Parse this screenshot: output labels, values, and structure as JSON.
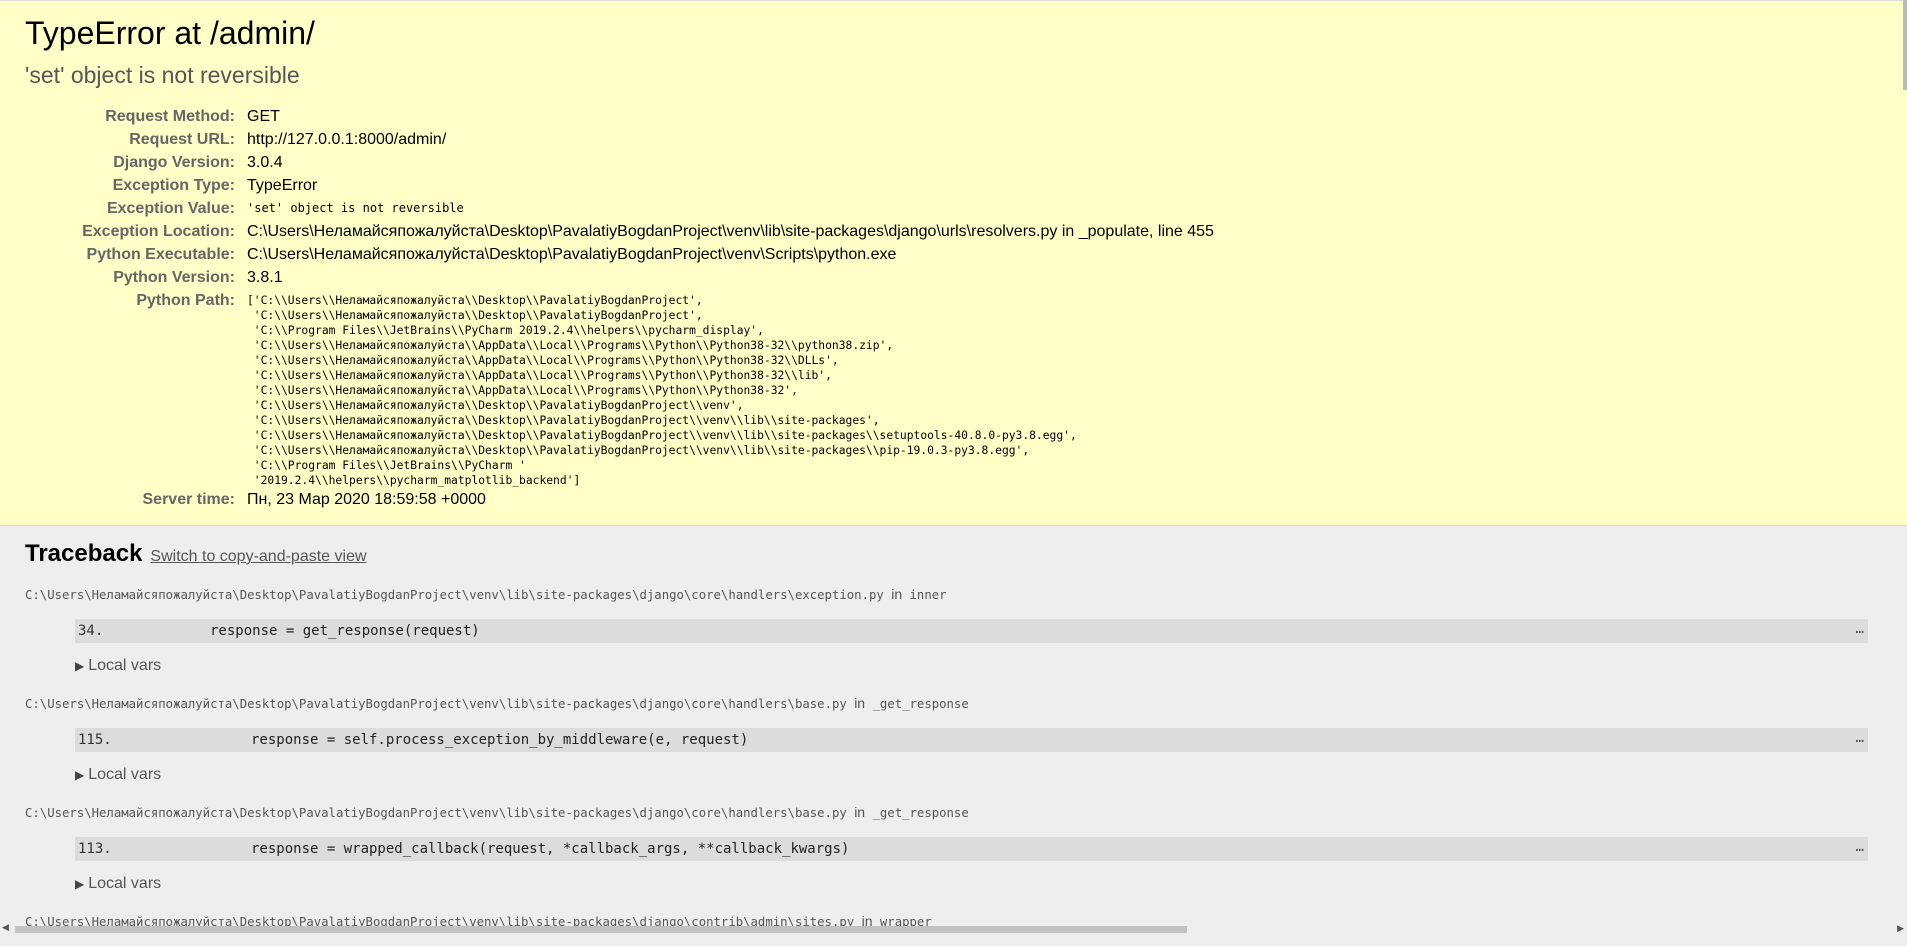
{
  "summary": {
    "title": "TypeError at /admin/",
    "subtitle": "'set' object is not reversible",
    "rows": [
      {
        "label": "Request Method:",
        "value": "GET"
      },
      {
        "label": "Request URL:",
        "value": "http://127.0.0.1:8000/admin/"
      },
      {
        "label": "Django Version:",
        "value": "3.0.4"
      },
      {
        "label": "Exception Type:",
        "value": "TypeError"
      },
      {
        "label": "Exception Value:",
        "value": "'set' object is not reversible"
      },
      {
        "label": "Exception Location:",
        "value": "C:\\Users\\Неламайсяпожалуйста\\Desktop\\PavalatiyBogdanProject\\venv\\lib\\site-packages\\django\\urls\\resolvers.py in _populate, line 455"
      },
      {
        "label": "Python Executable:",
        "value": "C:\\Users\\Неламайсяпожалуйста\\Desktop\\PavalatiyBogdanProject\\venv\\Scripts\\python.exe"
      },
      {
        "label": "Python Version:",
        "value": "3.8.1"
      },
      {
        "label": "Python Path:",
        "value": "['C:\\\\Users\\\\Неламайсяпожалуйста\\\\Desktop\\\\PavalatiyBogdanProject',\n 'C:\\\\Users\\\\Неламайсяпожалуйста\\\\Desktop\\\\PavalatiyBogdanProject',\n 'C:\\\\Program Files\\\\JetBrains\\\\PyCharm 2019.2.4\\\\helpers\\\\pycharm_display',\n 'C:\\\\Users\\\\Неламайсяпожалуйста\\\\AppData\\\\Local\\\\Programs\\\\Python\\\\Python38-32\\\\python38.zip',\n 'C:\\\\Users\\\\Неламайсяпожалуйста\\\\AppData\\\\Local\\\\Programs\\\\Python\\\\Python38-32\\\\DLLs',\n 'C:\\\\Users\\\\Неламайсяпожалуйста\\\\AppData\\\\Local\\\\Programs\\\\Python\\\\Python38-32\\\\lib',\n 'C:\\\\Users\\\\Неламайсяпожалуйста\\\\AppData\\\\Local\\\\Programs\\\\Python\\\\Python38-32',\n 'C:\\\\Users\\\\Неламайсяпожалуйста\\\\Desktop\\\\PavalatiyBogdanProject\\\\venv',\n 'C:\\\\Users\\\\Неламайсяпожалуйста\\\\Desktop\\\\PavalatiyBogdanProject\\\\venv\\\\lib\\\\site-packages',\n 'C:\\\\Users\\\\Неламайсяпожалуйста\\\\Desktop\\\\PavalatiyBogdanProject\\\\venv\\\\lib\\\\site-packages\\\\setuptools-40.8.0-py3.8.egg',\n 'C:\\\\Users\\\\Неламайсяпожалуйста\\\\Desktop\\\\PavalatiyBogdanProject\\\\venv\\\\lib\\\\site-packages\\\\pip-19.0.3-py3.8.egg',\n 'C:\\\\Program Files\\\\JetBrains\\\\PyCharm '\n '2019.2.4\\\\helpers\\\\pycharm_matplotlib_backend']"
      },
      {
        "label": "Server time:",
        "value": "Пн, 23 Мар 2020 18:59:58 +0000"
      }
    ]
  },
  "traceback": {
    "title": "Traceback",
    "switch_link": "Switch to copy-and-paste view",
    "in_word": "in",
    "frames": [
      {
        "file": "C:\\Users\\Неламайсяпожалуйста\\Desktop\\PavalatiyBogdanProject\\venv\\lib\\site-packages\\django\\core\\handlers\\exception.py",
        "func": "inner",
        "lineno": "34.",
        "code": "response = get_response(request)",
        "locals": "Local vars"
      },
      {
        "file": "C:\\Users\\Неламайсяпожалуйста\\Desktop\\PavalatiyBogdanProject\\venv\\lib\\site-packages\\django\\core\\handlers\\base.py",
        "func": "_get_response",
        "lineno": "115.",
        "code": "response = self.process_exception_by_middleware(e, request)",
        "locals": "Local vars"
      },
      {
        "file": "C:\\Users\\Неламайсяпожалуйста\\Desktop\\PavalatiyBogdanProject\\venv\\lib\\site-packages\\django\\core\\handlers\\base.py",
        "func": "_get_response",
        "lineno": "113.",
        "code": "response = wrapped_callback(request, *callback_args, **callback_kwargs)",
        "locals": "Local vars"
      },
      {
        "file": "C:\\Users\\Неламайсяпожалуйста\\Desktop\\PavalatiyBogdanProject\\venv\\lib\\site-packages\\django\\contrib\\admin\\sites.py",
        "func": "wrapper"
      }
    ],
    "ellipsis": "…"
  }
}
